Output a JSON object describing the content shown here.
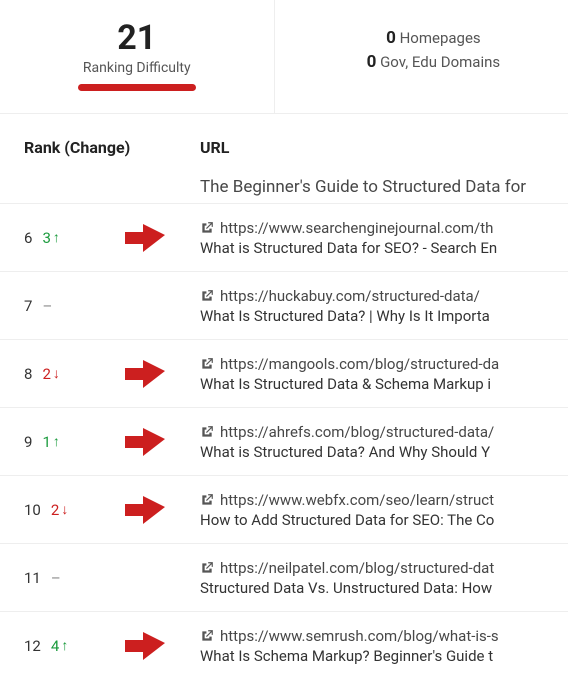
{
  "metric": {
    "value": "21",
    "label": "Ranking Difficulty"
  },
  "stats": {
    "homepages": {
      "value": "0",
      "label": "Homepages"
    },
    "gov_edu": {
      "value": "0",
      "label": "Gov, Edu Domains"
    }
  },
  "columns": {
    "rank": "Rank (Change)",
    "url": "URL"
  },
  "partial_prev_title": "The Beginner's Guide to Structured Data for",
  "rows": [
    {
      "rank": "6",
      "change": {
        "value": "3",
        "dir": "up"
      },
      "flag": true,
      "url": "https://www.searchenginejournal.com/th",
      "title": "What is Structured Data for SEO? - Search En"
    },
    {
      "rank": "7",
      "change": {
        "value": "–",
        "dir": "none"
      },
      "flag": false,
      "url": "https://huckabuy.com/structured-data/",
      "title": "What Is Structured Data? | Why Is It Importa"
    },
    {
      "rank": "8",
      "change": {
        "value": "2",
        "dir": "down"
      },
      "flag": true,
      "url": "https://mangools.com/blog/structured-da",
      "title": "What Is Structured Data & Schema Markup i"
    },
    {
      "rank": "9",
      "change": {
        "value": "1",
        "dir": "up"
      },
      "flag": true,
      "url": "https://ahrefs.com/blog/structured-data/",
      "title": "What is Structured Data? And Why Should Y"
    },
    {
      "rank": "10",
      "change": {
        "value": "2",
        "dir": "down"
      },
      "flag": true,
      "url": "https://www.webfx.com/seo/learn/struct",
      "title": "How to Add Structured Data for SEO: The Co"
    },
    {
      "rank": "11",
      "change": {
        "value": "–",
        "dir": "none"
      },
      "flag": false,
      "url": "https://neilpatel.com/blog/structured-dat",
      "title": "Structured Data Vs. Unstructured Data: How"
    },
    {
      "rank": "12",
      "change": {
        "value": "4",
        "dir": "up"
      },
      "flag": true,
      "url": "https://www.semrush.com/blog/what-is-s",
      "title": "What Is Schema Markup? Beginner's Guide t"
    }
  ]
}
